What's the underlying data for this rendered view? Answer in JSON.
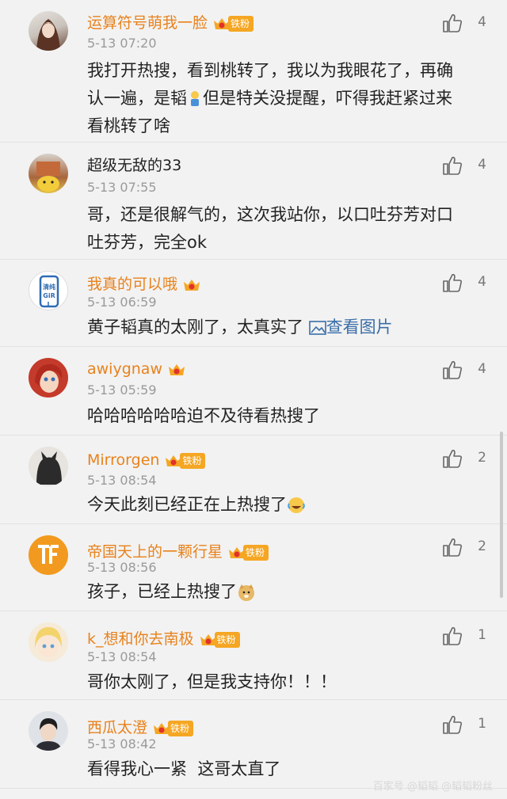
{
  "comments": [
    {
      "user": "运算符号萌我一脸",
      "time": "5-13 07:20",
      "likes": "4",
      "fan": "铁粉",
      "lines": [
        "我打开热搜，看到桃转了，我以为我眼花了，再确",
        "认一遍，是韬",
        "但是特关没提醒，吓得我赶紧过来",
        "看桃转了啥"
      ]
    },
    {
      "user": "超级无敌的33",
      "time": "5-13 07:55",
      "likes": "4",
      "lines": [
        "哥，还是很解气的，这次我站你，以口吐芬芳对口",
        "吐芬芳，完全ok"
      ]
    },
    {
      "user": "我真的可以哦",
      "time": "5-13 06:59",
      "likes": "4",
      "lines": [
        "黄子韬真的太刚了，太真实了"
      ],
      "view_image": "查看图片"
    },
    {
      "user": "awiygnaw",
      "time": "5-13 05:59",
      "likes": "4",
      "lines": [
        "哈哈哈哈哈哈迫不及待看热搜了"
      ]
    },
    {
      "user": "Mirrorgen",
      "time": "5-13 08:54",
      "likes": "2",
      "fan": "铁粉",
      "lines": [
        "今天此刻已经正在上热搜了"
      ]
    },
    {
      "user": "帝国天上的一颗行星",
      "time": "5-13 08:56",
      "likes": "2",
      "fan": "铁粉",
      "lines": [
        "孩子，已经上热搜了"
      ]
    },
    {
      "user": "k_想和你去南极",
      "time": "5-13 08:54",
      "likes": "1",
      "fan": "铁粉",
      "lines": [
        "哥你太刚了，但是我支持你！！！"
      ]
    },
    {
      "user": "西瓜太澄",
      "time": "5-13 08:42",
      "likes": "1",
      "fan": "铁粉",
      "lines": [
        "看得我心一紧  这哥太直了"
      ]
    }
  ],
  "avatar_label": "清纯GiRL",
  "watermark": "百家号 @韬韬 @韬韬粉丝",
  "colors": {
    "username": "#e8821c",
    "time": "#9a9a9a",
    "text": "#222222",
    "link": "#3a6ea8",
    "badge": "#f5a623"
  }
}
